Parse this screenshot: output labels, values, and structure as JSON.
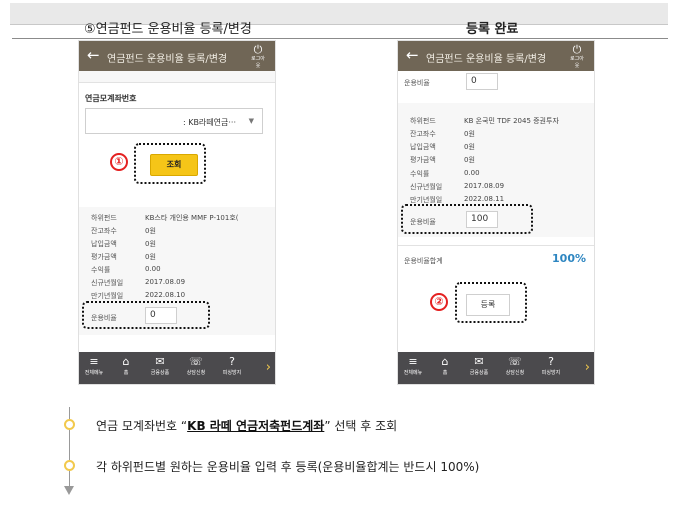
{
  "header": {
    "left_title": "⑤연금펀드 운용비율 등록/변경",
    "right_title": "등록 완료"
  },
  "app": {
    "bar_title": "연금펀드 운용비율 등록/변경",
    "back_glyph": "←",
    "power_label": "로그아웃",
    "power_icon": "power-icon"
  },
  "left_screen": {
    "account_label": "연금모계좌번호",
    "account_value": ": KB라떼연금···",
    "query_button": "조회",
    "fields": [
      {
        "label": "하위펀드",
        "value": "KB스타 개인용 MMF P-101호("
      },
      {
        "label": "잔고좌수",
        "value": "0원"
      },
      {
        "label": "납입금액",
        "value": "0원"
      },
      {
        "label": "평가금액",
        "value": "0원"
      },
      {
        "label": "수익률",
        "value": "0.00"
      },
      {
        "label": "신규년월일",
        "value": "2017.08.09"
      },
      {
        "label": "만기년월일",
        "value": "2022.08.10"
      }
    ],
    "ratio_label": "운용비율",
    "ratio_value": "0"
  },
  "right_screen": {
    "top_ratio_label": "운용비율",
    "top_ratio_value": "0",
    "fields": [
      {
        "label": "하위펀드",
        "value": "KB 온국민 TDF 2045 증권투자"
      },
      {
        "label": "잔고좌수",
        "value": "0원"
      },
      {
        "label": "납입금액",
        "value": "0원"
      },
      {
        "label": "평가금액",
        "value": "0원"
      },
      {
        "label": "수익률",
        "value": "0.00"
      },
      {
        "label": "신규년월일",
        "value": "2017.08.09"
      },
      {
        "label": "만기년월일",
        "value": "2022.08.11"
      }
    ],
    "ratio_label": "운용비율",
    "ratio_value": "100",
    "total_label": "운용비율합계",
    "total_value": "100%",
    "register_button": "등록"
  },
  "markers": {
    "one": "①",
    "two": "②"
  },
  "bottom_nav": [
    {
      "icon": "≡",
      "label": "전체메뉴"
    },
    {
      "icon": "⌂",
      "label": "홈"
    },
    {
      "icon": "✉",
      "label": "금융상품"
    },
    {
      "icon": "☏",
      "label": "상담신청"
    },
    {
      "icon": "?",
      "label": "피싱방지"
    }
  ],
  "nav_next": "›",
  "steps": [
    {
      "prefix": "연금 모계좌번호 “",
      "bold": "KB 라떼 연금저축펀드계좌",
      "suffix": "” 선택 후 조회"
    },
    {
      "prefix": "각 하위펀드별 원하는 운용비율 입력 후 등록(운용비율합계는 반드시 100%)",
      "bold": "",
      "suffix": ""
    }
  ],
  "colors": {
    "app_bar": "#706656",
    "nav_bar": "#4b4a4d",
    "accent_yellow": "#f5c518",
    "marker_red": "#e42020",
    "total_blue": "#2e86c1"
  }
}
